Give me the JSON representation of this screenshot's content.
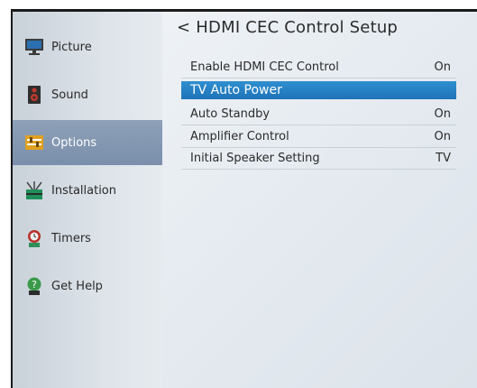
{
  "sidebar": {
    "items": [
      {
        "label": "Picture",
        "icon": "monitor-icon"
      },
      {
        "label": "Sound",
        "icon": "speaker-icon"
      },
      {
        "label": "Options",
        "icon": "options-icon",
        "selected": true
      },
      {
        "label": "Installation",
        "icon": "antenna-icon"
      },
      {
        "label": "Timers",
        "icon": "timer-icon"
      },
      {
        "label": "Get Help",
        "icon": "help-icon"
      }
    ]
  },
  "main": {
    "back_glyph": "<",
    "title": "HDMI CEC Control Setup",
    "rows": [
      {
        "label": "Enable HDMI CEC  Control",
        "value": "On"
      },
      {
        "label": "TV Auto Power",
        "value": "",
        "highlighted": true
      },
      {
        "label": "Auto Standby",
        "value": "On"
      },
      {
        "label": "Amplifier Control",
        "value": "On"
      },
      {
        "label": "Initial Speaker Setting",
        "value": "TV"
      }
    ]
  },
  "colors": {
    "highlight": "#1f78bd",
    "sidebar_selected": "#8197b2"
  }
}
